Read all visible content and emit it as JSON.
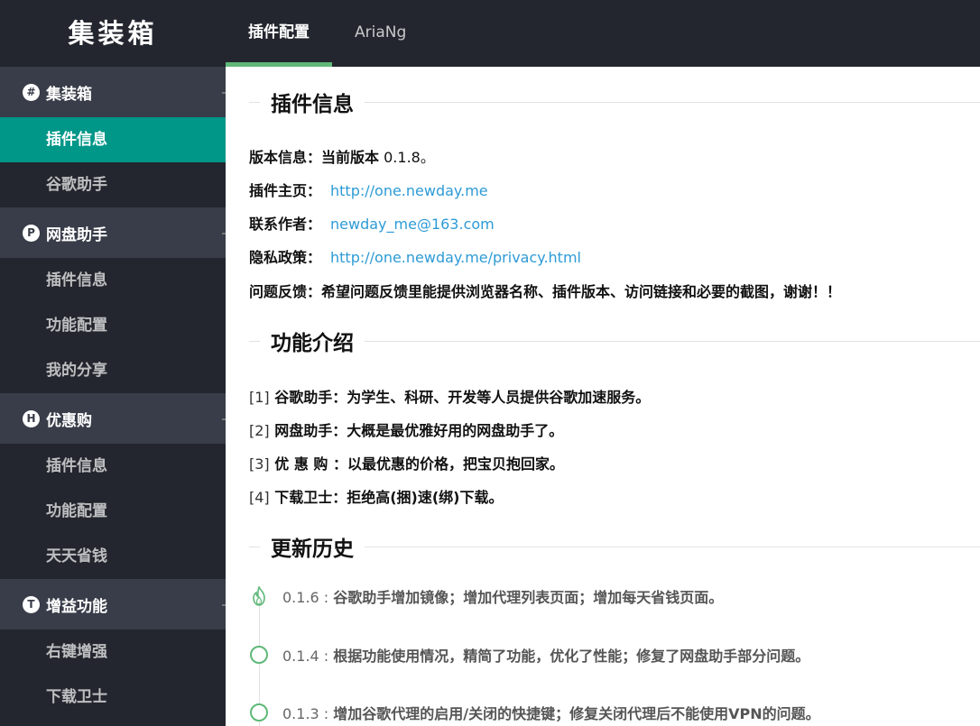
{
  "app": {
    "logo": "集装箱"
  },
  "tabs": [
    {
      "label": "插件配置",
      "active": true
    },
    {
      "label": "AriaNg",
      "active": false
    }
  ],
  "sidebar": {
    "groups": [
      {
        "icon": "#",
        "icon_name": "hash-icon",
        "title": "集装箱",
        "items": [
          {
            "label": "插件信息",
            "active": true
          },
          {
            "label": "谷歌助手",
            "active": false
          }
        ]
      },
      {
        "icon": "P",
        "icon_name": "p-circle-icon",
        "title": "网盘助手",
        "items": [
          {
            "label": "插件信息"
          },
          {
            "label": "功能配置"
          },
          {
            "label": "我的分享"
          }
        ]
      },
      {
        "icon": "H",
        "icon_name": "h-circle-icon",
        "title": "优惠购",
        "items": [
          {
            "label": "插件信息"
          },
          {
            "label": "功能配置"
          },
          {
            "label": "天天省钱"
          }
        ]
      },
      {
        "icon": "T",
        "icon_name": "t-circle-icon",
        "title": "增益功能",
        "items": [
          {
            "label": "右键增强"
          },
          {
            "label": "下载卫士"
          }
        ]
      }
    ]
  },
  "main": {
    "plugin_info": {
      "title": "插件信息",
      "version_label": "版本信息：",
      "version_prefix": "当前版本",
      "version_value": " 0.1.8。",
      "homepage_label": "插件主页：",
      "homepage_link": "http://one.newday.me",
      "author_label": "联系作者：",
      "author_link": "newday_me@163.com",
      "privacy_label": "隐私政策：",
      "privacy_link": "http://one.newday.me/privacy.html",
      "feedback_label": "问题反馈：",
      "feedback_text": "希望问题反馈里能提供浏览器名称、插件版本、访问链接和必要的截图，谢谢！！"
    },
    "features": {
      "title": "功能介绍",
      "items": [
        {
          "num": "[1]",
          "text": " 谷歌助手：为学生、科研、开发等人员提供谷歌加速服务。"
        },
        {
          "num": "[2]",
          "text": " 网盘助手：大概是最优雅好用的网盘助手了。"
        },
        {
          "num": "[3]",
          "text": " 优 惠 购 ：以最优惠的价格，把宝贝抱回家。"
        },
        {
          "num": "[4]",
          "text": " 下载卫士：拒绝高(捆)速(绑)下载。"
        }
      ]
    },
    "history": {
      "title": "更新历史",
      "items": [
        {
          "version": "0.1.6 : ",
          "desc": "谷歌助手增加镜像；增加代理列表页面；增加每天省钱页面。",
          "icon": "fire-icon"
        },
        {
          "version": "0.1.4 : ",
          "desc": "根据功能使用情况，精简了功能，优化了性能；修复了网盘助手部分问题。",
          "icon": "circle-icon"
        },
        {
          "version": "0.1.3 : ",
          "desc": "增加谷歌代理的启用/关闭的快捷键；修复关闭代理后不能使用VPN的问题。",
          "icon": "circle-icon"
        }
      ]
    }
  },
  "colors": {
    "topbar": "#23262e",
    "group_head": "#393d49",
    "active_item": "#009688",
    "tab_underline": "#5fb878",
    "link": "#2d9bd6",
    "timeline": "#5fb878"
  }
}
